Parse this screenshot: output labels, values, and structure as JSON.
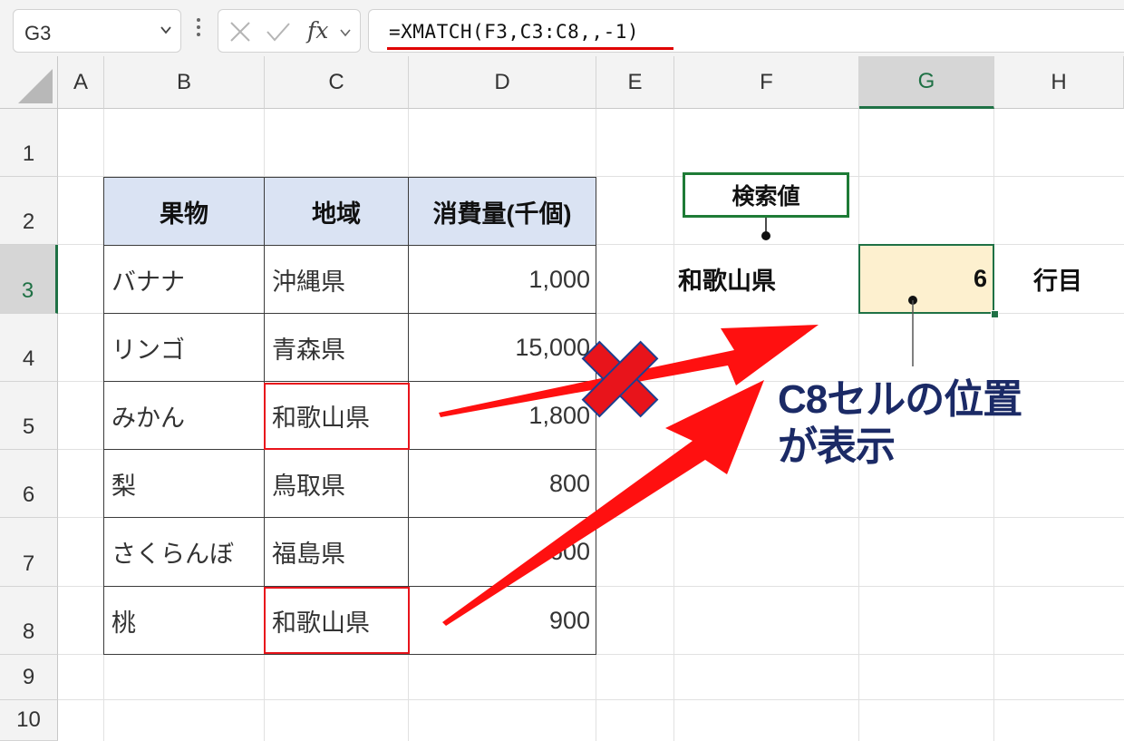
{
  "formula_bar": {
    "name_box": "G3",
    "cancel_icon": "close-icon",
    "enter_icon": "check-icon",
    "fx_label": "fx",
    "formula": "=XMATCH(F3,C3:C8,,-1)"
  },
  "columns": [
    "A",
    "B",
    "C",
    "D",
    "E",
    "F",
    "G",
    "H"
  ],
  "rows": [
    "1",
    "2",
    "3",
    "4",
    "5",
    "6",
    "7",
    "8",
    "9",
    "10"
  ],
  "selected_cell": "G3",
  "table": {
    "headers": [
      "果物",
      "地域",
      "消費量(千個)"
    ],
    "rows": [
      [
        "バナナ",
        "沖縄県",
        "1,000"
      ],
      [
        "リンゴ",
        "青森県",
        "15,000"
      ],
      [
        "みかん",
        "和歌山県",
        "1,800"
      ],
      [
        "梨",
        "鳥取県",
        "800"
      ],
      [
        "さくらんぼ",
        "福島県",
        "600"
      ],
      [
        "桃",
        "和歌山県",
        "900"
      ]
    ]
  },
  "lookup": {
    "label": "検索値",
    "value": "和歌山県",
    "result": "6",
    "suffix": "行目"
  },
  "annotation": {
    "line1": "C8セルの位置",
    "line2": "が表示"
  },
  "colors": {
    "accent_green": "#1f7145",
    "highlight_red": "#e8141b",
    "table_header_bg": "#dae3f3",
    "result_bg": "#fdf0cf",
    "callout_text": "#1b2a66"
  }
}
